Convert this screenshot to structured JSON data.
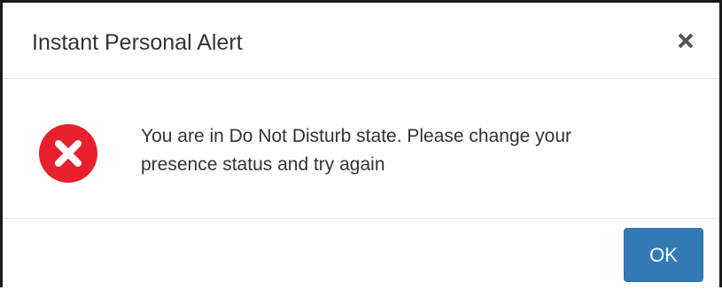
{
  "dialog": {
    "title": "Instant Personal Alert",
    "close_icon": "close-icon",
    "status_icon": "error-icon",
    "message_line1": "You are in Do Not Disturb state. Please change your",
    "message_line2": "presence status and try again",
    "ok_label": "OK"
  },
  "colors": {
    "error": "#e8202e",
    "primary_button": "#337ab7",
    "text": "#333333",
    "divider": "#e5e5e5"
  }
}
